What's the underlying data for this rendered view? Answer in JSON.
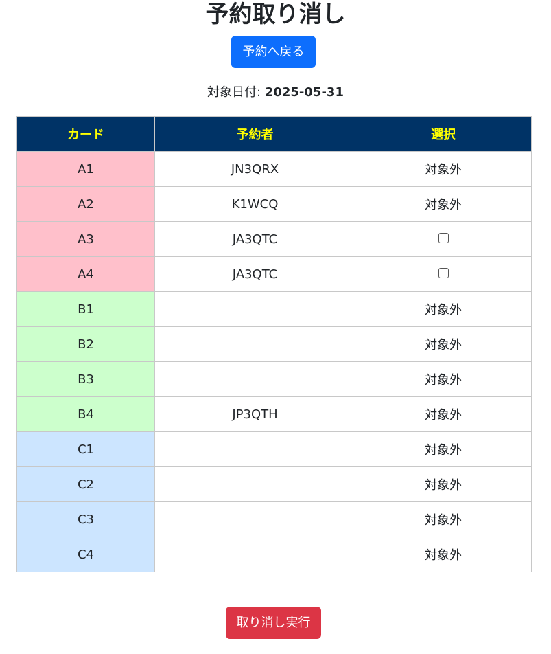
{
  "page": {
    "title": "予約取り消し",
    "back_button_label": "予約へ戻る",
    "date_label": "対象日付:",
    "date_value": "2025-05-31",
    "execute_button_label": "取り消し実行"
  },
  "table": {
    "headers": [
      "カード",
      "予約者",
      "選択"
    ],
    "rows": [
      {
        "card": "A1",
        "reserver": "JN3QRX",
        "select": "対象外",
        "checkbox": false,
        "group": "a"
      },
      {
        "card": "A2",
        "reserver": "K1WCQ",
        "select": "対象外",
        "checkbox": false,
        "group": "a"
      },
      {
        "card": "A3",
        "reserver": "JA3QTC",
        "select": "",
        "checkbox": true,
        "group": "a"
      },
      {
        "card": "A4",
        "reserver": "JA3QTC",
        "select": "",
        "checkbox": true,
        "group": "a"
      },
      {
        "card": "B1",
        "reserver": "",
        "select": "対象外",
        "checkbox": false,
        "group": "b"
      },
      {
        "card": "B2",
        "reserver": "",
        "select": "対象外",
        "checkbox": false,
        "group": "b"
      },
      {
        "card": "B3",
        "reserver": "",
        "select": "対象外",
        "checkbox": false,
        "group": "b"
      },
      {
        "card": "B4",
        "reserver": "JP3QTH",
        "select": "対象外",
        "checkbox": false,
        "group": "b"
      },
      {
        "card": "C1",
        "reserver": "",
        "select": "対象外",
        "checkbox": false,
        "group": "c"
      },
      {
        "card": "C2",
        "reserver": "",
        "select": "対象外",
        "checkbox": false,
        "group": "c"
      },
      {
        "card": "C3",
        "reserver": "",
        "select": "対象外",
        "checkbox": false,
        "group": "c"
      },
      {
        "card": "C4",
        "reserver": "",
        "select": "対象外",
        "checkbox": false,
        "group": "c"
      }
    ]
  },
  "colors": {
    "header_bg": "#003366",
    "header_text": "#ffff00",
    "group_a": "#ffc0cb",
    "group_b": "#ccffcc",
    "group_c": "#cce5ff",
    "back_button": "#0d6efd",
    "execute_button": "#dc3545"
  }
}
